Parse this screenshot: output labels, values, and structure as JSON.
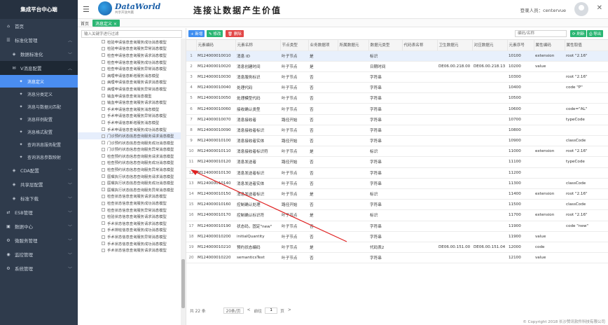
{
  "sidebar": {
    "brand": "集成平台中心端",
    "items": [
      {
        "label": "首页",
        "level": 0
      },
      {
        "label": "标准化管理",
        "level": 0,
        "open": true
      },
      {
        "label": "数据标准化",
        "level": 1
      },
      {
        "label": "V消息配置",
        "level": 1,
        "open": true
      },
      {
        "label": "消息定义",
        "level": 2,
        "selected": true
      },
      {
        "label": "消息分类定义",
        "level": 2
      },
      {
        "label": "消息与数据元匹配",
        "level": 2
      },
      {
        "label": "消息样例配置",
        "level": 2
      },
      {
        "label": "消息格式配置",
        "level": 2
      },
      {
        "label": "查询消息服务配置",
        "level": 2
      },
      {
        "label": "查询消息参数映射",
        "level": 2
      },
      {
        "label": "CDA配置",
        "level": 1
      },
      {
        "label": "共享层配置",
        "level": 1
      },
      {
        "label": "标准下载",
        "level": 1
      },
      {
        "label": "ESB管理",
        "level": 0
      },
      {
        "label": "数据中心",
        "level": 0
      },
      {
        "label": "微服务管理",
        "level": 0
      },
      {
        "label": "监控管理",
        "level": 0
      },
      {
        "label": "系统管理",
        "level": 0
      }
    ]
  },
  "header": {
    "logo_text": "DataWorld",
    "logo_sub": "共享开放共赢",
    "slogan": "连接让数据产生价值",
    "login_label": "登录人员：centervue"
  },
  "tabs": {
    "home": "首页",
    "current": "消息定义 ×"
  },
  "tree": {
    "search_placeholder": "输入关键字进行过滤",
    "items": [
      "检验申请信息查询服务成功消息模型",
      "检验申请信息查询服务异常消息模型",
      "检查申请信息查询服务请求消息模型",
      "检查申请信息查询服务成功消息模型",
      "检查申请信息查询服务异常消息模型",
      "病理申请信息新增服务消息模型",
      "病理申请信息查询服务请求消息模型",
      "病理申请信息查询服务异常消息模型",
      "输血申请信息查询消息模型",
      "输血申请信息查询服务请求消息模型",
      "手术申请信息查询服务消息模型",
      "手术申请信息查询服务异常消息模型",
      "手术申请信息新增服务消息模型",
      "手术申请信息查询服务成功消息模型",
      "门诊预约状态信息查询服务请求消息模型",
      "门诊预约状态信息查询服务成功消息模型",
      "门诊预约状态信息查询服务异常消息模型",
      "检查预约状态信息查询服务请求消息模型",
      "检查预约状态信息查询服务成功消息模型",
      "检查预约状态信息查询服务异常消息模型",
      "医嘱执行状态信息查询服务请求消息模型",
      "医嘱执行状态信息查询服务成功消息模型",
      "医嘱执行状态信息查询服务异常消息模型",
      "检查状态信息查询服务请求消息模型",
      "检查状态信息查询服务成功消息模型",
      "检查状态信息查询服务异常消息模型",
      "检验状态信息查询服务请求消息模型",
      "手术状态信息查询服务请求消息模型",
      "手术排班信息查询服务成功消息模型",
      "手术状态信息查询服务异常消息模型",
      "手术状态信息查询服务成功消息模型",
      "手术状态信息查询服务请求消息模型"
    ],
    "highlighted_index": 14
  },
  "toolbar": {
    "add": "+ 新增",
    "edit": "✎ 修改",
    "delete": "🗑 删除",
    "code_placeholder": "编码/名称",
    "search": "⟳ 刷新",
    "export": "⎙ 导出"
  },
  "grid": {
    "columns": [
      "",
      "元素编码",
      "元素名称",
      "节点类型",
      "业务数据项",
      "所属数据元",
      "数据元类型",
      "代码表名称",
      "卫生数据元",
      "对应数据元",
      "元素序号",
      "属性编码",
      "属性取值"
    ],
    "rows": [
      [
        "1",
        "M124000010010",
        "消息 ID",
        "叶子节点",
        "是",
        "",
        "标识",
        "",
        "",
        "",
        "10100",
        "extension",
        "root \"2.16\""
      ],
      [
        "2",
        "M124000010020",
        "消息创建时间",
        "叶子节点",
        "是",
        "",
        "日期时间",
        "",
        "DE06.00.218.00",
        "DE06.00.218.13",
        "10200",
        "value",
        ""
      ],
      [
        "3",
        "M124000010030",
        "消息服务标识",
        "叶子节点",
        "否",
        "",
        "字符串",
        "",
        "",
        "",
        "10300",
        "",
        "root \"2.16\""
      ],
      [
        "4",
        "M124000010040",
        "处理代码",
        "叶子节点",
        "否",
        "",
        "字符串",
        "",
        "",
        "",
        "10400",
        "",
        "code \"P\""
      ],
      [
        "5",
        "M124000010050",
        "处理模型代码",
        "叶子节点",
        "否",
        "",
        "字符串",
        "",
        "",
        "",
        "10500",
        "",
        ""
      ],
      [
        "6",
        "M124000010060",
        "接收确认类型",
        "叶子节点",
        "否",
        "",
        "字符串",
        "",
        "",
        "",
        "10600",
        "",
        "code=\"AL\""
      ],
      [
        "7",
        "M124000010070",
        "消息接收者",
        "路径开始",
        "否",
        "",
        "字符串",
        "",
        "",
        "",
        "10700",
        "",
        "typeCode"
      ],
      [
        "8",
        "M124000010090",
        "消息接收者标识",
        "叶子节点",
        "否",
        "",
        "字符串",
        "",
        "",
        "",
        "10800",
        "",
        ""
      ],
      [
        "9",
        "M124000010100",
        "消息接收者实体",
        "路径开始",
        "否",
        "",
        "字符串",
        "",
        "",
        "",
        "10900",
        "",
        "classCode"
      ],
      [
        "10",
        "M124000010110",
        "消息接收者标识符",
        "叶子节点",
        "是",
        "",
        "标识",
        "",
        "",
        "",
        "11000",
        "extension",
        "root \"2.16\""
      ],
      [
        "11",
        "M124000010120",
        "消息发送者",
        "路径开始",
        "否",
        "",
        "字符串",
        "",
        "",
        "",
        "11100",
        "",
        "typeCode"
      ],
      [
        "12",
        "M124000010130",
        "消息发送者标识",
        "叶子节点",
        "否",
        "",
        "字符串",
        "",
        "",
        "",
        "11200",
        "",
        ""
      ],
      [
        "13",
        "M124000010140",
        "消息发送者实体",
        "叶子节点",
        "否",
        "",
        "字符串",
        "",
        "",
        "",
        "11300",
        "",
        "classCode"
      ],
      [
        "14",
        "M124000010150",
        "消息发送者标识",
        "叶子节点",
        "是",
        "",
        "标识",
        "",
        "",
        "",
        "11400",
        "extension",
        "root \"2.16\""
      ],
      [
        "15",
        "M124000010160",
        "控制确认处理",
        "路径开始",
        "否",
        "",
        "字符串",
        "",
        "",
        "",
        "11500",
        "",
        "classCode"
      ],
      [
        "16",
        "M124000010170",
        "控制确认标识符",
        "叶子节点",
        "是",
        "",
        "标识",
        "",
        "",
        "",
        "11700",
        "extension",
        "root \"2.16\""
      ],
      [
        "17",
        "M124000010190",
        "状态码，固定\"new\"",
        "叶子节点",
        "否",
        "",
        "字符串",
        "",
        "",
        "",
        "11900",
        "",
        "code \"new\""
      ],
      [
        "18",
        "M124000010200",
        "initialQuantity",
        "叶子节点",
        "否",
        "",
        "字符串",
        "",
        "",
        "",
        "11900",
        "value",
        ""
      ],
      [
        "19",
        "M124000010210",
        "预约状态编码",
        "叶子节点",
        "是",
        "",
        "代码表2",
        "",
        "DE06.00.151.00",
        "DE06.00.151.04",
        "12000",
        "code",
        ""
      ],
      [
        "20",
        "M124000010220",
        "semanticsText",
        "叶子节点",
        "否",
        "",
        "字符串",
        "",
        "",
        "",
        "12100",
        "value",
        ""
      ]
    ],
    "selected_row": 0
  },
  "pager": {
    "total": "共 22 条",
    "page_size": "20条/页",
    "prev": "<",
    "goto": "前往",
    "page": "1",
    "page_unit": "页",
    "next": ">"
  },
  "footer": {
    "copyright": "© Copyright 2018 长沙赞讯软件科技有限公司"
  },
  "colors": {
    "sidebar_bg": "#2f3b4c",
    "accent_blue": "#3f8ef0",
    "accent_green": "#2bb673",
    "danger": "#e24848",
    "annotation_arrow": "#e02020"
  }
}
